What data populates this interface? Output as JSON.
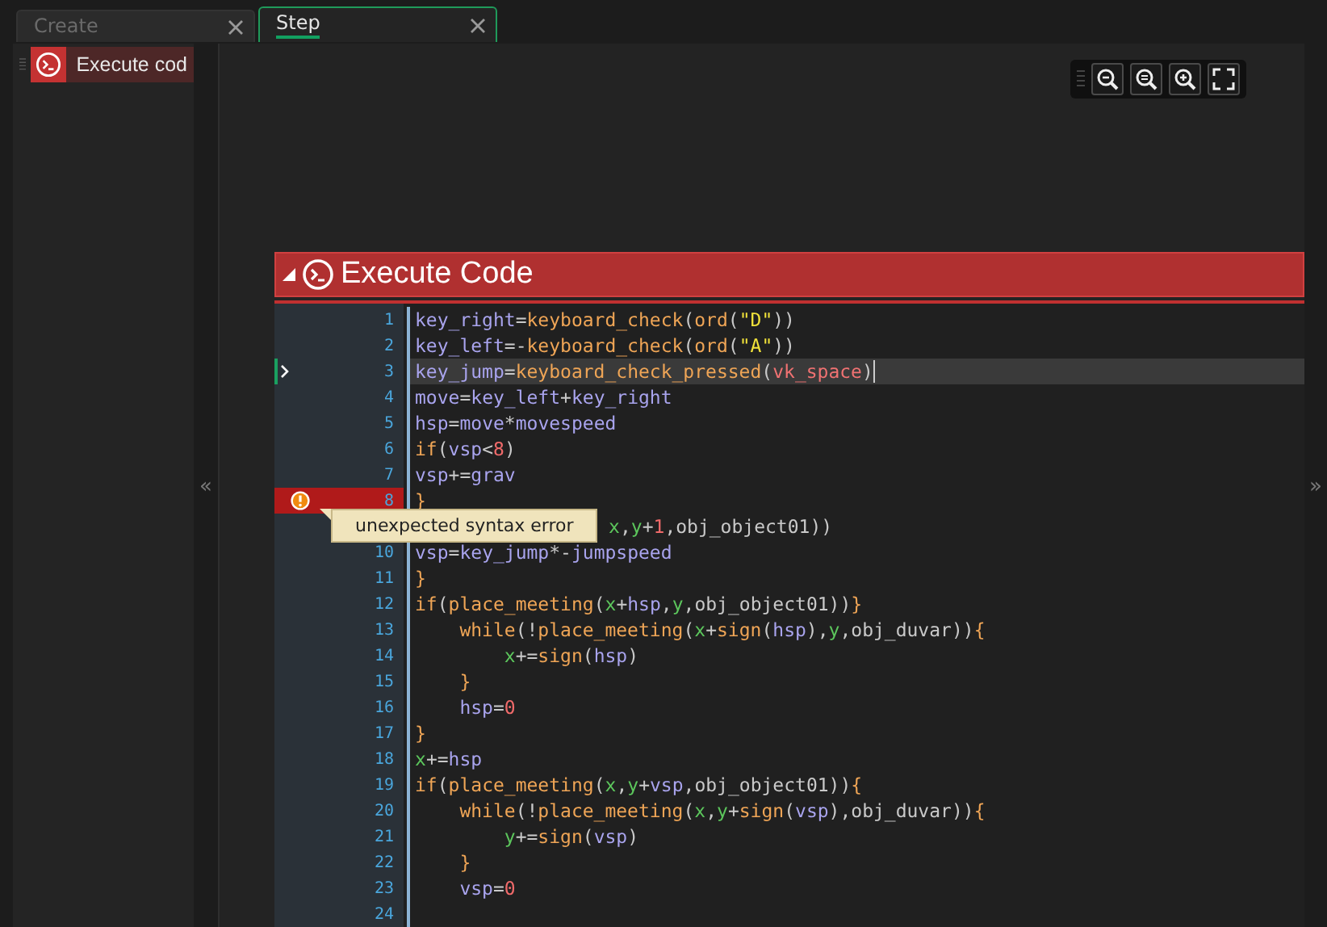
{
  "tabs": [
    {
      "label": "Create",
      "selected": false
    },
    {
      "label": "Step",
      "selected": true
    }
  ],
  "events": [
    {
      "label": "Execute cod",
      "selected": true
    }
  ],
  "block": {
    "title": "Execute Code",
    "expanded": true
  },
  "tooltip": "unexpected syntax error",
  "lines": [
    {
      "number": "1",
      "kind": "normal",
      "tokens": [
        {
          "text": "key_right",
          "kind": "var"
        },
        {
          "text": "=",
          "kind": "punct"
        },
        {
          "text": "keyboard_check",
          "kind": "func"
        },
        {
          "text": "(",
          "kind": "punct"
        },
        {
          "text": "ord",
          "kind": "func"
        },
        {
          "text": "(",
          "kind": "punct"
        },
        {
          "text": "\"D\"",
          "kind": "string"
        },
        {
          "text": "))",
          "kind": "punct"
        }
      ]
    },
    {
      "number": "2",
      "kind": "normal",
      "tokens": [
        {
          "text": "key_left",
          "kind": "var"
        },
        {
          "text": "=-",
          "kind": "punct"
        },
        {
          "text": "keyboard_check",
          "kind": "func"
        },
        {
          "text": "(",
          "kind": "punct"
        },
        {
          "text": "ord",
          "kind": "func"
        },
        {
          "text": "(",
          "kind": "punct"
        },
        {
          "text": "\"A\"",
          "kind": "string"
        },
        {
          "text": "))",
          "kind": "punct"
        }
      ]
    },
    {
      "number": "3",
      "kind": "current",
      "tokens": [
        {
          "text": "key_jump",
          "kind": "var"
        },
        {
          "text": "=",
          "kind": "punct"
        },
        {
          "text": "keyboard_check_pressed",
          "kind": "func"
        },
        {
          "text": "(",
          "kind": "punct"
        },
        {
          "text": "vk_space",
          "kind": "constant"
        },
        {
          "text": ")",
          "kind": "punct"
        }
      ]
    },
    {
      "number": "4",
      "kind": "normal",
      "tokens": [
        {
          "text": "move",
          "kind": "var"
        },
        {
          "text": "=",
          "kind": "punct"
        },
        {
          "text": "key_left",
          "kind": "var"
        },
        {
          "text": "+",
          "kind": "punct"
        },
        {
          "text": "key_right",
          "kind": "var"
        }
      ]
    },
    {
      "number": "5",
      "kind": "normal",
      "tokens": [
        {
          "text": "hsp",
          "kind": "var"
        },
        {
          "text": "=",
          "kind": "punct"
        },
        {
          "text": "move",
          "kind": "var"
        },
        {
          "text": "*",
          "kind": "punct"
        },
        {
          "text": "movespeed",
          "kind": "var"
        }
      ]
    },
    {
      "number": "6",
      "kind": "normal",
      "tokens": [
        {
          "text": "if",
          "kind": "func"
        },
        {
          "text": "(",
          "kind": "punct"
        },
        {
          "text": "vsp",
          "kind": "var"
        },
        {
          "text": "<",
          "kind": "punct"
        },
        {
          "text": "8",
          "kind": "number"
        },
        {
          "text": ")",
          "kind": "punct"
        }
      ]
    },
    {
      "number": "7",
      "kind": "normal",
      "tokens": [
        {
          "text": "vsp",
          "kind": "var"
        },
        {
          "text": "+=",
          "kind": "punct"
        },
        {
          "text": "grav",
          "kind": "var"
        }
      ]
    },
    {
      "number": "8",
      "kind": "error",
      "tokens": [
        {
          "text": "}",
          "kind": "brace"
        }
      ]
    },
    {
      "kind": "covered",
      "tokens": [
        {
          "text": "x",
          "kind": "builtin"
        },
        {
          "text": ",",
          "kind": "punct"
        },
        {
          "text": "y",
          "kind": "builtin"
        },
        {
          "text": "+",
          "kind": "punct"
        },
        {
          "text": "1",
          "kind": "number"
        },
        {
          "text": ",obj_object01))",
          "kind": "punct"
        }
      ]
    },
    {
      "number": "10",
      "kind": "normal",
      "tokens": [
        {
          "text": "vsp",
          "kind": "var"
        },
        {
          "text": "=",
          "kind": "punct"
        },
        {
          "text": "key_jump",
          "kind": "var"
        },
        {
          "text": "*-",
          "kind": "punct"
        },
        {
          "text": "jumpspeed",
          "kind": "var"
        }
      ]
    },
    {
      "number": "11",
      "kind": "normal",
      "tokens": [
        {
          "text": "}",
          "kind": "brace"
        }
      ]
    },
    {
      "number": "12",
      "kind": "normal",
      "tokens": [
        {
          "text": "if",
          "kind": "func"
        },
        {
          "text": "(",
          "kind": "punct"
        },
        {
          "text": "place_meeting",
          "kind": "func"
        },
        {
          "text": "(",
          "kind": "punct"
        },
        {
          "text": "x",
          "kind": "builtin"
        },
        {
          "text": "+",
          "kind": "punct"
        },
        {
          "text": "hsp",
          "kind": "var"
        },
        {
          "text": ",",
          "kind": "punct"
        },
        {
          "text": "y",
          "kind": "builtin"
        },
        {
          "text": ",obj_object01))",
          "kind": "punct"
        },
        {
          "text": "}",
          "kind": "brace"
        }
      ]
    },
    {
      "number": "13",
      "kind": "normal",
      "tokens": [
        {
          "text": "    while",
          "kind": "func"
        },
        {
          "text": "(!",
          "kind": "punct"
        },
        {
          "text": "place_meeting",
          "kind": "func"
        },
        {
          "text": "(",
          "kind": "punct"
        },
        {
          "text": "x",
          "kind": "builtin"
        },
        {
          "text": "+",
          "kind": "punct"
        },
        {
          "text": "sign",
          "kind": "func"
        },
        {
          "text": "(",
          "kind": "punct"
        },
        {
          "text": "hsp",
          "kind": "var"
        },
        {
          "text": "),",
          "kind": "punct"
        },
        {
          "text": "y",
          "kind": "builtin"
        },
        {
          "text": ",obj_duvar))",
          "kind": "punct"
        },
        {
          "text": "{",
          "kind": "brace"
        }
      ]
    },
    {
      "number": "14",
      "kind": "normal",
      "tokens": [
        {
          "text": "        x",
          "kind": "builtin"
        },
        {
          "text": "+=",
          "kind": "punct"
        },
        {
          "text": "sign",
          "kind": "func"
        },
        {
          "text": "(",
          "kind": "punct"
        },
        {
          "text": "hsp",
          "kind": "var"
        },
        {
          "text": ")",
          "kind": "punct"
        }
      ]
    },
    {
      "number": "15",
      "kind": "normal",
      "tokens": [
        {
          "text": "    }",
          "kind": "brace"
        }
      ]
    },
    {
      "number": "16",
      "kind": "normal",
      "tokens": [
        {
          "text": "    hsp",
          "kind": "var"
        },
        {
          "text": "=",
          "kind": "punct"
        },
        {
          "text": "0",
          "kind": "number"
        }
      ]
    },
    {
      "number": "17",
      "kind": "normal",
      "tokens": [
        {
          "text": "}",
          "kind": "brace"
        }
      ]
    },
    {
      "number": "18",
      "kind": "normal",
      "tokens": [
        {
          "text": "x",
          "kind": "builtin"
        },
        {
          "text": "+=",
          "kind": "punct"
        },
        {
          "text": "hsp",
          "kind": "var"
        }
      ]
    },
    {
      "number": "19",
      "kind": "normal",
      "tokens": [
        {
          "text": "if",
          "kind": "func"
        },
        {
          "text": "(",
          "kind": "punct"
        },
        {
          "text": "place_meeting",
          "kind": "func"
        },
        {
          "text": "(",
          "kind": "punct"
        },
        {
          "text": "x",
          "kind": "builtin"
        },
        {
          "text": ",",
          "kind": "punct"
        },
        {
          "text": "y",
          "kind": "builtin"
        },
        {
          "text": "+",
          "kind": "punct"
        },
        {
          "text": "vsp",
          "kind": "var"
        },
        {
          "text": ",obj_object01))",
          "kind": "punct"
        },
        {
          "text": "{",
          "kind": "brace"
        }
      ]
    },
    {
      "number": "20",
      "kind": "normal",
      "tokens": [
        {
          "text": "    while",
          "kind": "func"
        },
        {
          "text": "(!",
          "kind": "punct"
        },
        {
          "text": "place_meeting",
          "kind": "func"
        },
        {
          "text": "(",
          "kind": "punct"
        },
        {
          "text": "x",
          "kind": "builtin"
        },
        {
          "text": ",",
          "kind": "punct"
        },
        {
          "text": "y",
          "kind": "builtin"
        },
        {
          "text": "+",
          "kind": "punct"
        },
        {
          "text": "sign",
          "kind": "func"
        },
        {
          "text": "(",
          "kind": "punct"
        },
        {
          "text": "vsp",
          "kind": "var"
        },
        {
          "text": "),obj_duvar))",
          "kind": "punct"
        },
        {
          "text": "{",
          "kind": "brace"
        }
      ]
    },
    {
      "number": "21",
      "kind": "normal",
      "tokens": [
        {
          "text": "        y",
          "kind": "builtin"
        },
        {
          "text": "+=",
          "kind": "punct"
        },
        {
          "text": "sign",
          "kind": "func"
        },
        {
          "text": "(",
          "kind": "punct"
        },
        {
          "text": "vsp",
          "kind": "var"
        },
        {
          "text": ")",
          "kind": "punct"
        }
      ]
    },
    {
      "number": "22",
      "kind": "normal",
      "tokens": [
        {
          "text": "    }",
          "kind": "brace"
        }
      ]
    },
    {
      "number": "23",
      "kind": "normal",
      "tokens": [
        {
          "text": "    vsp",
          "kind": "var"
        },
        {
          "text": "=",
          "kind": "punct"
        },
        {
          "text": "0",
          "kind": "number"
        }
      ]
    },
    {
      "number": "24",
      "kind": "normal"
    }
  ],
  "collapse_left": "«",
  "collapse_right": "»"
}
